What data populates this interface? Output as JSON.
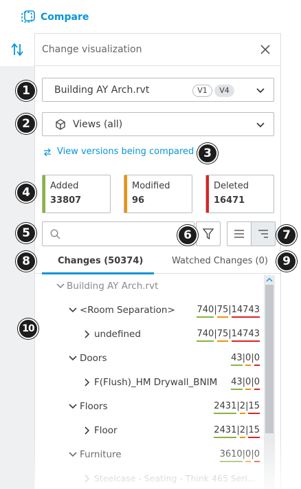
{
  "toolbar": {
    "compare_label": "Compare"
  },
  "panel": {
    "title": "Change visualization",
    "file_select": {
      "value": "Building AY Arch.rvt",
      "version_a": "V1",
      "version_b": "V4"
    },
    "view_select": {
      "value": "Views (all)"
    },
    "versions_link": "View versions being compared"
  },
  "stats": [
    {
      "label": "Added",
      "value": "33807",
      "color": "#87b340"
    },
    {
      "label": "Modified",
      "value": "96",
      "color": "#f29100"
    },
    {
      "label": "Deleted",
      "value": "16471",
      "color": "#dd2222"
    }
  ],
  "search": {
    "placeholder": "",
    "value": ""
  },
  "tabs": [
    {
      "label": "Changes (50374)",
      "active": true
    },
    {
      "label": "Watched Changes (0)",
      "active": false
    }
  ],
  "tree": [
    {
      "name": "Building AY Arch.rvt",
      "added": "",
      "modified": "",
      "deleted": ""
    },
    {
      "name": "<Room Separation>",
      "added": "740",
      "modified": "75",
      "deleted": "14743"
    },
    {
      "name": "undefined",
      "added": "740",
      "modified": "75",
      "deleted": "14743"
    },
    {
      "name": "Doors",
      "added": "43",
      "modified": "0",
      "deleted": "0"
    },
    {
      "name": "F(Flush)_HM Drywall_BNIM",
      "added": "43",
      "modified": "0",
      "deleted": "0"
    },
    {
      "name": "Floors",
      "added": "2431",
      "modified": "2",
      "deleted": "15"
    },
    {
      "name": "Floor",
      "added": "2431",
      "modified": "2",
      "deleted": "15"
    },
    {
      "name": "Furniture",
      "added": "3610",
      "modified": "0",
      "deleted": "0"
    },
    {
      "name": "Steelcase - Seating - Think 465 Seri...",
      "added": "",
      "modified": "",
      "deleted": ""
    }
  ],
  "badges": [
    "1",
    "2",
    "3",
    "4",
    "5",
    "6",
    "7",
    "8",
    "9",
    "10"
  ],
  "icons": {
    "compare": "compare-icon",
    "rail": "sort-arrows-icon",
    "close": "close-icon",
    "cube": "cube-icon",
    "swap": "swap-arrows-icon",
    "search": "search-icon",
    "filter": "filter-icon",
    "list": "list-view-icon",
    "indent": "indent-view-icon"
  },
  "colors": {
    "accent": "#0696d7",
    "added": "#87b340",
    "modified": "#f29100",
    "deleted": "#dd2222"
  }
}
